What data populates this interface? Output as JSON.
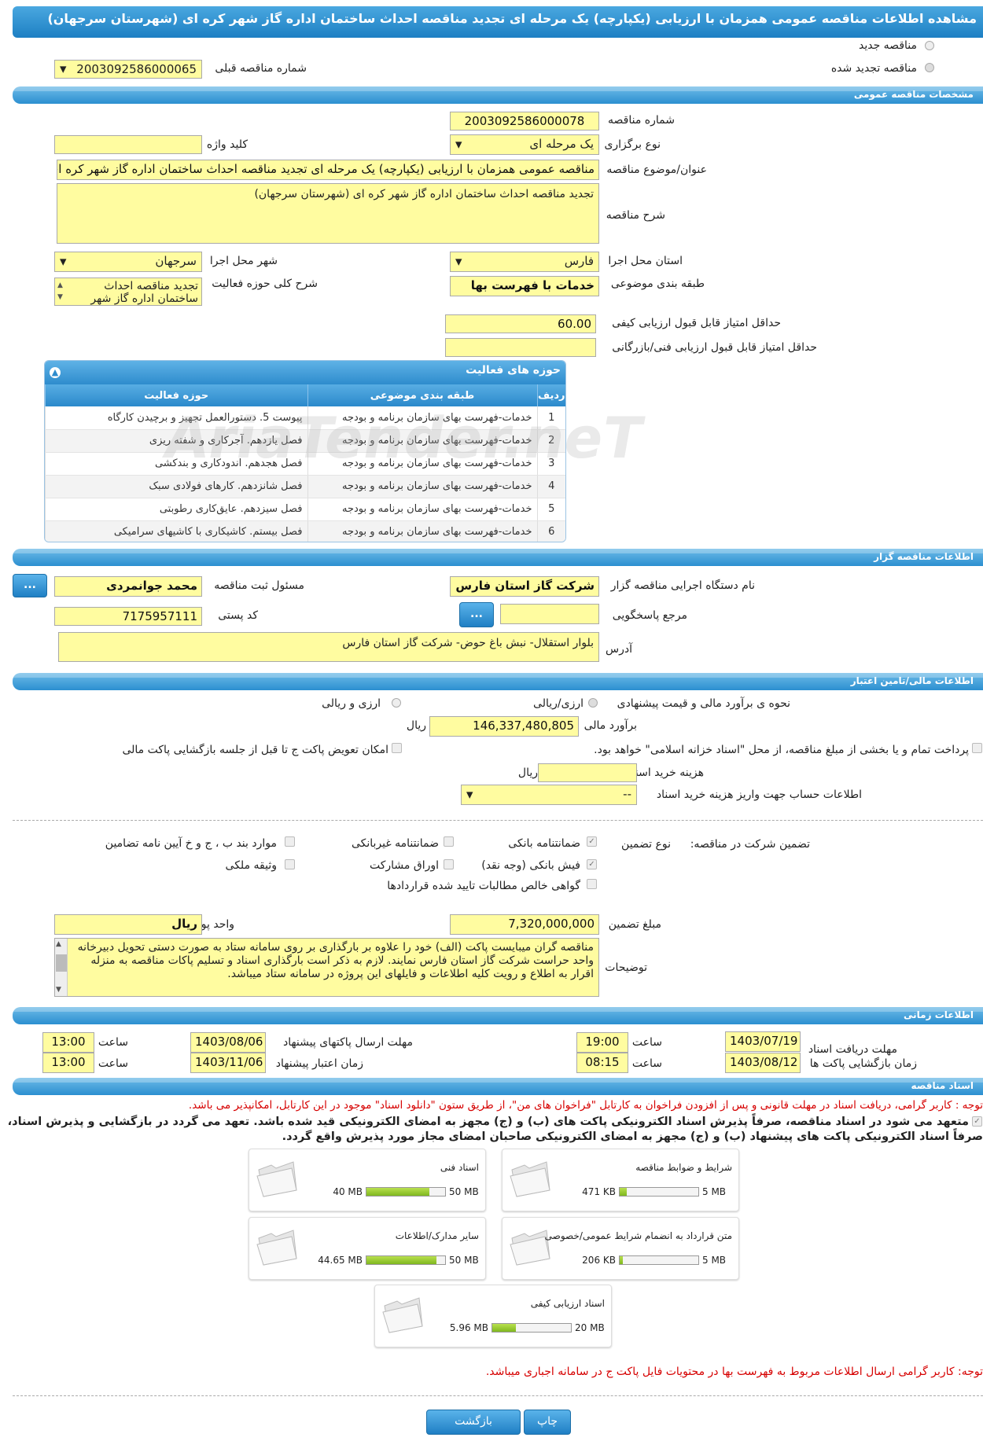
{
  "title": "مشاهده اطلاعات مناقصه عمومی همزمان با ارزیابی (یکپارچه) یک مرحله ای تجدید مناقصه احداث ساختمان اداره گاز شهر کره ای (شهرستان سرجهان)",
  "tender_type": {
    "new_label": "مناقصه جدید",
    "renewed_label": "مناقصه تجدید شده",
    "prev_number_label": "شماره مناقصه قبلی",
    "prev_number": "2003092586000065"
  },
  "general": {
    "section": "مشخصات مناقصه عمومی",
    "number_label": "شماره مناقصه",
    "number": "2003092586000078",
    "holding_label": "نوع برگزاری",
    "holding": "یک مرحله ای",
    "keyword_label": "کلید واژه",
    "keyword": "",
    "subject_label": "عنوان/موضوع مناقصه",
    "subject": "مناقصه عمومی همزمان با ارزیابی (یکپارچه) یک مرحله ای تجدید مناقصه احداث ساختمان اداره گاز شهر کره ای",
    "desc_label": "شرح مناقصه",
    "desc": "تجدید مناقصه احداث ساختمان اداره گاز شهر کره ای (شهرستان سرجهان)",
    "province_label": "استان محل اجرا",
    "province": "فارس",
    "city_label": "شهر محل اجرا",
    "city": "سرجهان",
    "category_label": "طبقه بندی موضوعی",
    "category": "خدمات با فهرست بها",
    "scope_label": "شرح کلی حوزه فعالیت",
    "scope": "تجدید مناقصه احداث ساختمان اداره گاز شهر",
    "min_quality_label": "حداقل امتیاز قابل قبول ارزیابی کیفی",
    "min_quality": "60.00",
    "min_tech_label": "حداقل امتیاز قابل قبول ارزیابی فنی/بازرگانی",
    "min_tech": ""
  },
  "activity": {
    "title": "حوزه های فعالیت",
    "headers": [
      "ردیف",
      "طبقه بندی موضوعی",
      "حوزه فعالیت"
    ],
    "rows": [
      [
        "1",
        "خدمات-فهرست بهای سازمان برنامه و بودجه",
        "پیوست 5. دستورالعمل تجهیز و برچیدن کارگاه"
      ],
      [
        "2",
        "خدمات-فهرست بهای سازمان برنامه و بودجه",
        "فصل یازدهم. آجرکاری و شفته ریزی"
      ],
      [
        "3",
        "خدمات-فهرست بهای سازمان برنامه و بودجه",
        "فصل هجدهم. اندودکاری و بندکشی"
      ],
      [
        "4",
        "خدمات-فهرست بهای سازمان برنامه و بودجه",
        "فصل شانزدهم. کارهای فولادی سبک"
      ],
      [
        "5",
        "خدمات-فهرست بهای سازمان برنامه و بودجه",
        "فصل سیزدهم. عایق‌کاری رطوبتی"
      ],
      [
        "6",
        "خدمات-فهرست بهای سازمان برنامه و بودجه",
        "فصل بیستم. کاشیکاری با کاشیهای سرامیکی"
      ]
    ]
  },
  "organizer": {
    "section": "اطلاعات مناقصه گزار",
    "agency_label": "نام دستگاه اجرایی مناقصه گزار",
    "agency": "شرکت گاز استان فارس",
    "registrar_label": "مسئول ثبت مناقصه",
    "registrar": "محمد  جوانمردی",
    "ref_label": "مرجع پاسخگویی",
    "ref": "",
    "postal_label": "کد پستی",
    "postal": "7175957111",
    "address_label": "آدرس",
    "address": "بلوار استقلال- نبش باغ حوض- شرکت گاز استان فارس",
    "more_btn": "..."
  },
  "finance": {
    "section": "اطلاعات مالی/تامین اعتبار",
    "estimate_type_label": "نحوه ی برآورد مالی و قیمت پیشنهادی",
    "opt1": "ارزی/ریالی",
    "opt2": "ارزی و ریالی",
    "estimate_label": "برآورد مالی",
    "estimate": "146,337,480,805",
    "rial": "ریال",
    "treasury_text": "پرداخت تمام و یا بخشی از مبلغ مناقصه، از محل \"اسناد خزانه اسلامی\" خواهد بود.",
    "swap_text": "امکان تعویض پاکت ج تا قبل از جلسه بازگشایی پاکت مالی",
    "doc_cost_label": "هزینه خرید اسناد",
    "doc_cost": "",
    "account_label": "اطلاعات حساب جهت واریز هزینه خرید اسناد",
    "account": "--"
  },
  "guarantee": {
    "participation_label": "تضمین شرکت در مناقصه:",
    "type_label": "نوع تضمین",
    "bank_guarantee": "ضمانتنامه بانکی",
    "non_bank": "ضمانتنامه غیربانکی",
    "clauses": "موارد بند ب ، ج و خ آیین نامه تضامین",
    "cash": "فیش بانکی (وجه نقد)",
    "bonds": "اوراق مشارکت",
    "property": "وثیقه ملکی",
    "claims": "گواهی خالص مطالبات تایید شده قراردادها",
    "amount_label": "مبلغ تضمین",
    "amount": "7,320,000,000",
    "currency_label": "واحد پول",
    "currency": "ریال",
    "notes_label": "توضیحات",
    "notes": "مناقصه گران میبایست پاکت (الف) خود را علاوه بر بارگذاری بر روی سامانه ستاد به صورت دستی تحویل دبیرخانه واحد حراست شرکت گاز استان فارس نمایند. لازم به ذکر است بارگذاری اسناد و تسلیم پاکات مناقصه به منزله  اقرار به اطلاع و رویت کلیه اطلاعات و فایلهای این پروژه در سامانه ستاد میباشد."
  },
  "timing": {
    "section": "اطلاعات زمانی",
    "receive_label": "مهلت دریافت اسناد",
    "receive_date": "1403/07/19",
    "receive_time": "19:00",
    "send_label": "مهلت ارسال پاکتهای پیشنهاد",
    "send_date": "1403/08/06",
    "send_time": "13:00",
    "open_label": "زمان بازگشایی پاکت ها",
    "open_date": "1403/08/12",
    "open_time": "08:15",
    "validity_label": "زمان اعتبار پیشنهاد",
    "validity_date": "1403/11/06",
    "validity_time": "13:00",
    "time_label": "ساعت"
  },
  "documents": {
    "section": "اسناد مناقصه",
    "notice": "توجه : کاربر گرامی، دریافت اسناد در مهلت قانونی و پس از افزودن فراخوان به کارتابل \"فراخوان های من\"، از طریق ستون \"دانلود اسناد\" موجود در این کارتابل، امکانپذیر می باشد.",
    "commit_line1": "متعهد می شود در اسناد مناقصه، صرفاً پذیرش اسناد الکترونیکی پاکت های (ب) و (ج) مجهز به امضای الکترونیکی قید شده باشد. تعهد می گردد در بازگشایی و پذیرش اسناد،",
    "commit_line2": "صرفاً اسناد الکترونیکی پاکت های پیشنهاد (ب) و (ج) مجهز به امضای الکترونیکی صاحبان امضای مجاز مورد پذیرش واقع گردد.",
    "files": [
      {
        "name": "شرایط و ضوابط مناقصه",
        "used": "471 KB",
        "cap": "5 MB",
        "fill": 0.09
      },
      {
        "name": "اسناد فنی",
        "used": "40 MB",
        "cap": "50 MB",
        "fill": 0.8
      },
      {
        "name": "متن قرارداد به انضمام شرایط عمومی/خصوصی",
        "used": "206 KB",
        "cap": "5 MB",
        "fill": 0.04
      },
      {
        "name": "سایر مدارک/اطلاعات",
        "used": "44.65 MB",
        "cap": "50 MB",
        "fill": 0.89
      },
      {
        "name": "اسناد ارزیابی کیفی",
        "used": "5.96 MB",
        "cap": "20 MB",
        "fill": 0.3
      }
    ],
    "footer_notice": "توجه: کاربر گرامی ارسال اطلاعات مربوط به فهرست بها در محتویات فایل پاکت ج در سامانه اجباری میباشد."
  },
  "actions": {
    "print": "چاپ",
    "back": "بازگشت"
  },
  "watermark": "AriaTender.neT"
}
